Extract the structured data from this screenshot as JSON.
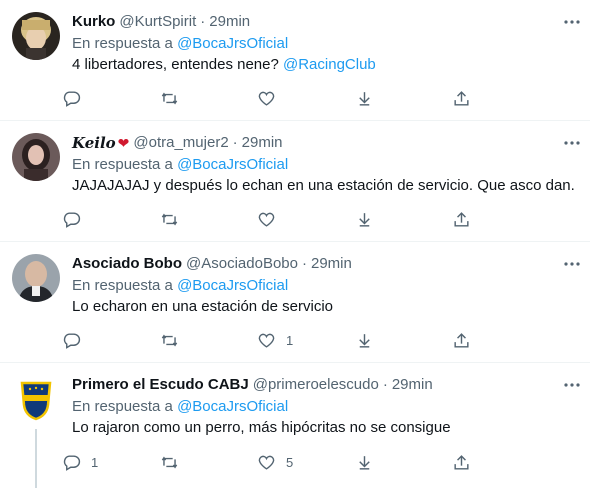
{
  "reply_prefix": "En respuesta a",
  "tweets": [
    {
      "name": "Kurko",
      "handle": "@KurtSpirit",
      "time": "29min",
      "reply_to": "@BocaJrsOficial",
      "text": "4 libertadores, entendes nene?",
      "text_mention": "@RacingClub",
      "counts": {
        "reply": "",
        "retweet": "",
        "like": ""
      }
    },
    {
      "name": "Keilo",
      "name_emoji": "❤",
      "handle": "@otra_mujer2",
      "time": "29min",
      "reply_to": "@BocaJrsOficial",
      "text": "JAJAJAJAJ y después lo echan en una estación de servicio. Que asco dan.",
      "counts": {
        "reply": "",
        "retweet": "",
        "like": ""
      }
    },
    {
      "name": "Asociado Bobo",
      "handle": "@AsociadoBobo",
      "time": "29min",
      "reply_to": "@BocaJrsOficial",
      "text": "Lo echaron en una estación de servicio",
      "counts": {
        "reply": "",
        "retweet": "",
        "like": "1"
      }
    },
    {
      "name": "Primero el Escudo CABJ",
      "handle": "@primeroelescudo",
      "time": "29min",
      "reply_to": "@BocaJrsOficial",
      "text": "Lo rajaron como un perro, más hipócritas no se consigue",
      "counts": {
        "reply": "1",
        "retweet": "",
        "like": "5"
      }
    }
  ],
  "separator": "·",
  "colors": {
    "accent": "#1d9bf0",
    "secondary_text": "#536471",
    "border": "#eff3f4"
  }
}
